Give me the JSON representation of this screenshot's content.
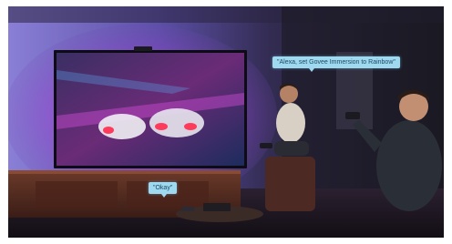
{
  "scene": {
    "description_colors": {
      "wall_left": "#6b63b8",
      "wall_right": "#23222f",
      "ambient_glow": "#c24dd8",
      "floor": "#241b22",
      "cabinet": "#5a2f24"
    }
  },
  "bubbles": {
    "right_text": "\"Alexa, set Govee Immersion to Rainbow\"",
    "left_text": "\"Okay\""
  }
}
